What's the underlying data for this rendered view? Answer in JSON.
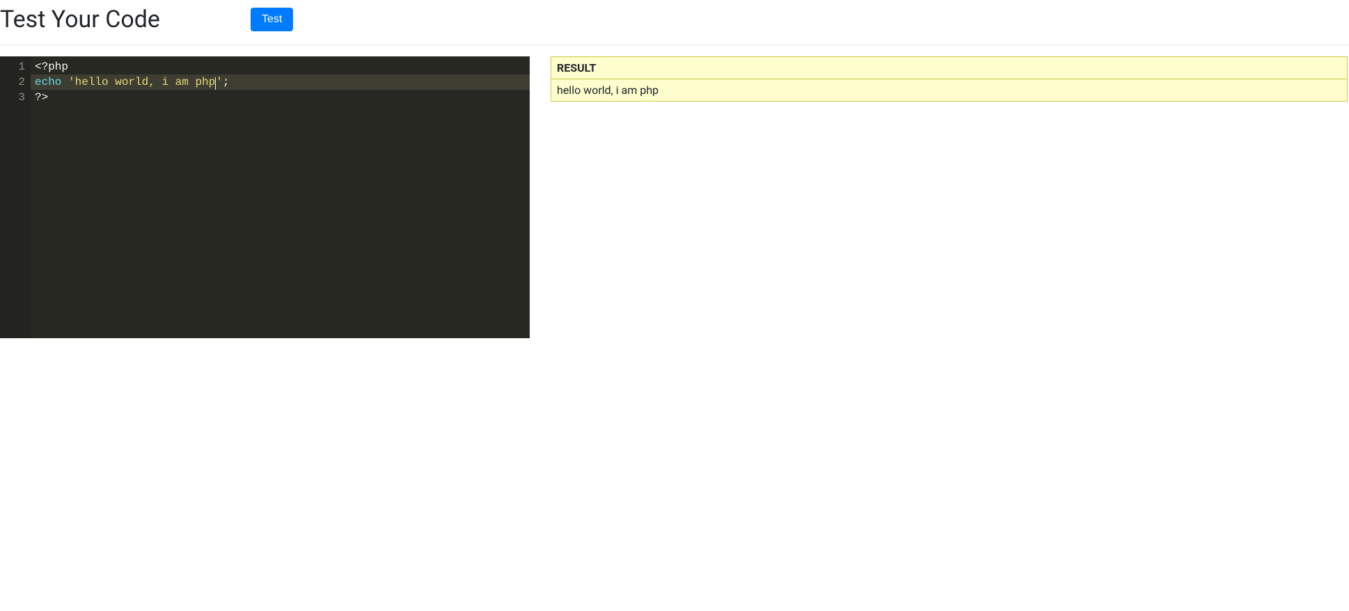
{
  "header": {
    "title": "Test Your Code",
    "test_button_label": "Test"
  },
  "editor": {
    "lines": [
      {
        "num": "1",
        "tokens": [
          {
            "text": "<?php",
            "cls": "tok-tag"
          }
        ],
        "active": false
      },
      {
        "num": "2",
        "tokens": [
          {
            "text": "echo",
            "cls": "tok-keyword"
          },
          {
            "text": " ",
            "cls": "tok-punct"
          },
          {
            "text": "'hello world, i am php'",
            "cls": "tok-string"
          },
          {
            "text": ";",
            "cls": "tok-punct"
          }
        ],
        "active": true,
        "cursor_after_token_index": 2
      },
      {
        "num": "3",
        "tokens": [
          {
            "text": "?>",
            "cls": "tok-tag"
          }
        ],
        "active": false
      }
    ]
  },
  "result": {
    "header": "RESULT",
    "body": "hello world, i am php"
  }
}
